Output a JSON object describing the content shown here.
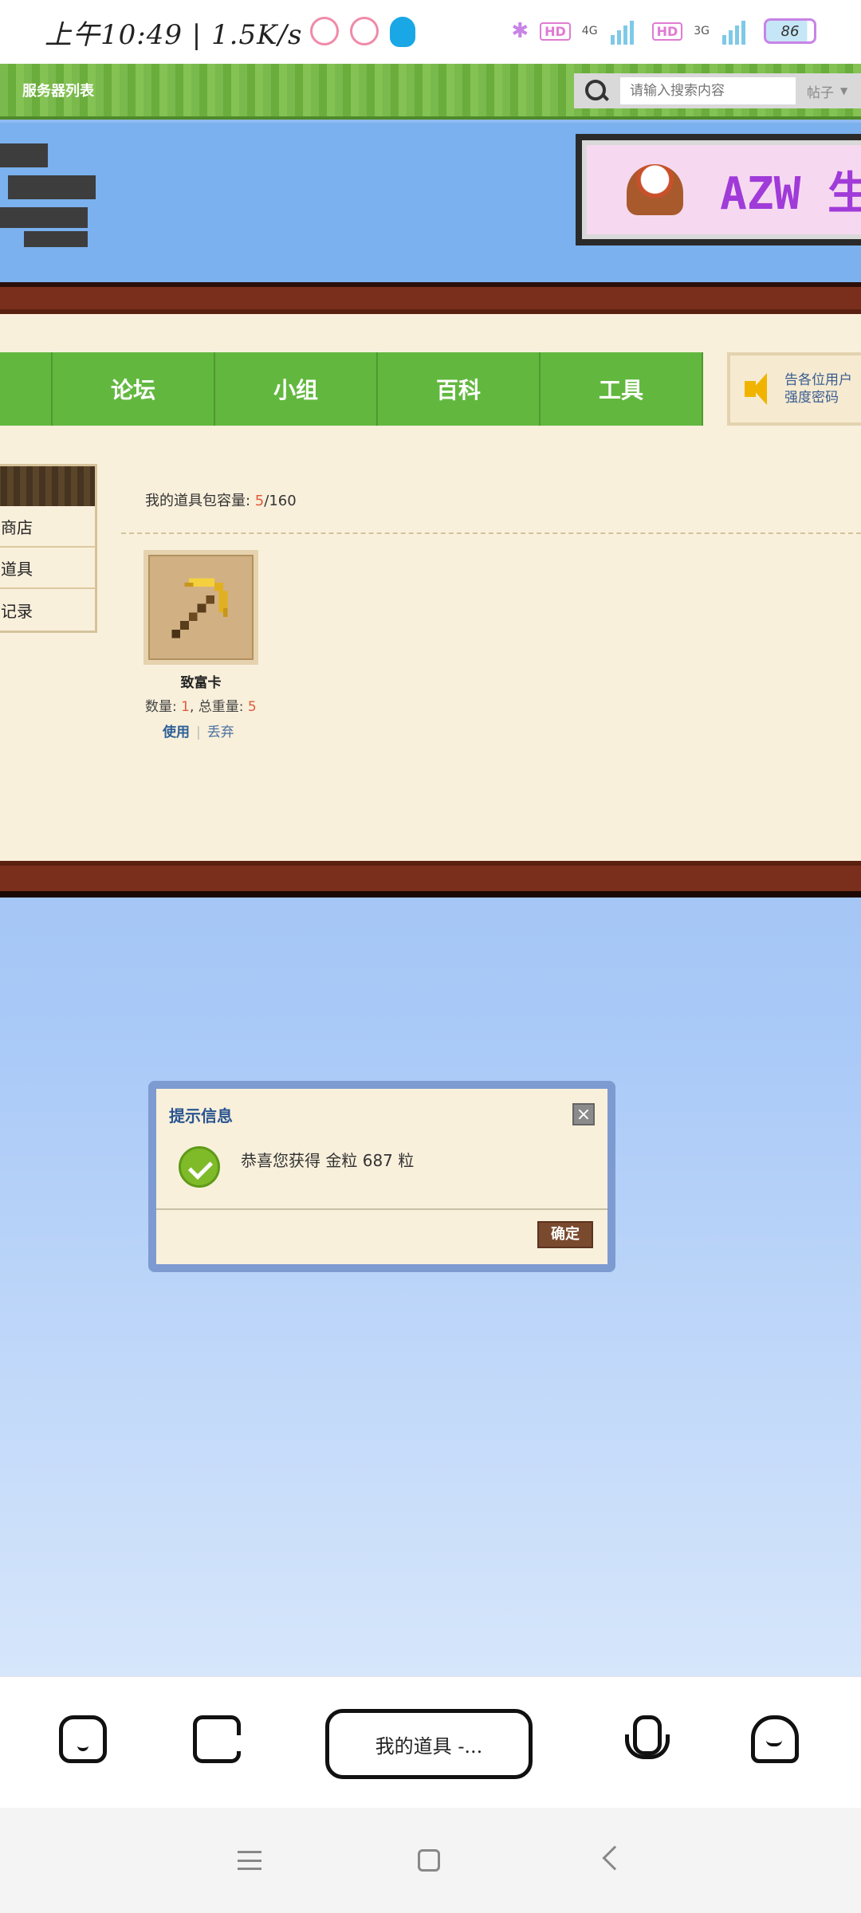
{
  "status_bar": {
    "time": "上午10:49 | 1.5K/s",
    "network_4g": "4G",
    "network_3g": "3G",
    "hd": "HD",
    "battery": "86"
  },
  "site_header": {
    "server_list_link": "服务器列表",
    "search": {
      "placeholder": "请输入搜索内容",
      "type_select": "帖子"
    }
  },
  "ad_banner": {
    "text": "AZW 生"
  },
  "nav": {
    "items": [
      {
        "label": "论坛"
      },
      {
        "label": "小组"
      },
      {
        "label": "百科"
      },
      {
        "label": "工具"
      }
    ],
    "notice": {
      "line1": "告各位用户",
      "line2": "强度密码"
    }
  },
  "side_menu": {
    "items": [
      {
        "label": "商店"
      },
      {
        "label": "道具"
      },
      {
        "label": "记录"
      }
    ]
  },
  "inventory": {
    "capacity_label": "我的道具包容量: ",
    "capacity_used": "5",
    "capacity_total": "/160",
    "items": [
      {
        "name": "致富卡",
        "qty_label": "数量: ",
        "qty": "1",
        "weight_label": ", 总重量: ",
        "weight": "5",
        "use_label": "使用",
        "separator": "|",
        "discard_label": "丢弃"
      }
    ]
  },
  "dialog": {
    "title": "提示信息",
    "close": "×",
    "message": "恭喜您获得 金粒 687 粒",
    "ok_label": "确定"
  },
  "browser_bar": {
    "address_text": "我的道具 -..."
  },
  "colors": {
    "nav_green": "#62b83f",
    "panel_bg": "#f9f0dc",
    "wood": "#7a2e1c",
    "highlight_number": "#e05a3c",
    "dialog_border": "#7d9bd1",
    "ok_button": "#7a4a2e"
  }
}
